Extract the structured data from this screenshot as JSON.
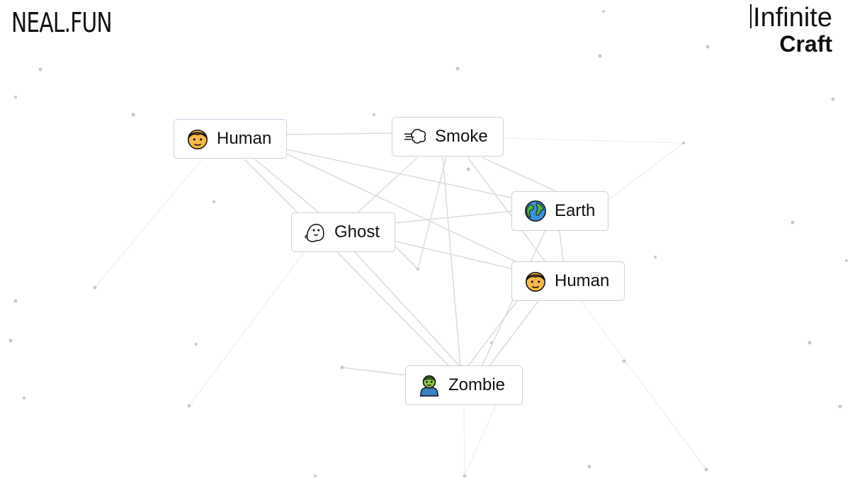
{
  "header": {
    "site_logo": "NEAL.FUN",
    "brand_line1": "Infinite",
    "brand_line2": "Craft"
  },
  "elements": [
    {
      "label": "Human",
      "icon": "human-face-icon"
    },
    {
      "label": "Smoke",
      "icon": "smoke-puff-icon"
    },
    {
      "label": "Earth",
      "icon": "earth-globe-icon"
    },
    {
      "label": "Ghost",
      "icon": "ghost-icon"
    },
    {
      "label": "Human",
      "icon": "human-face-icon"
    },
    {
      "label": "Zombie",
      "icon": "zombie-icon"
    }
  ],
  "colors": {
    "background": "#ffffff",
    "card_border": "#c7d5e3",
    "link_line": "#d9d9d9",
    "dot": "#c8c8c8"
  }
}
